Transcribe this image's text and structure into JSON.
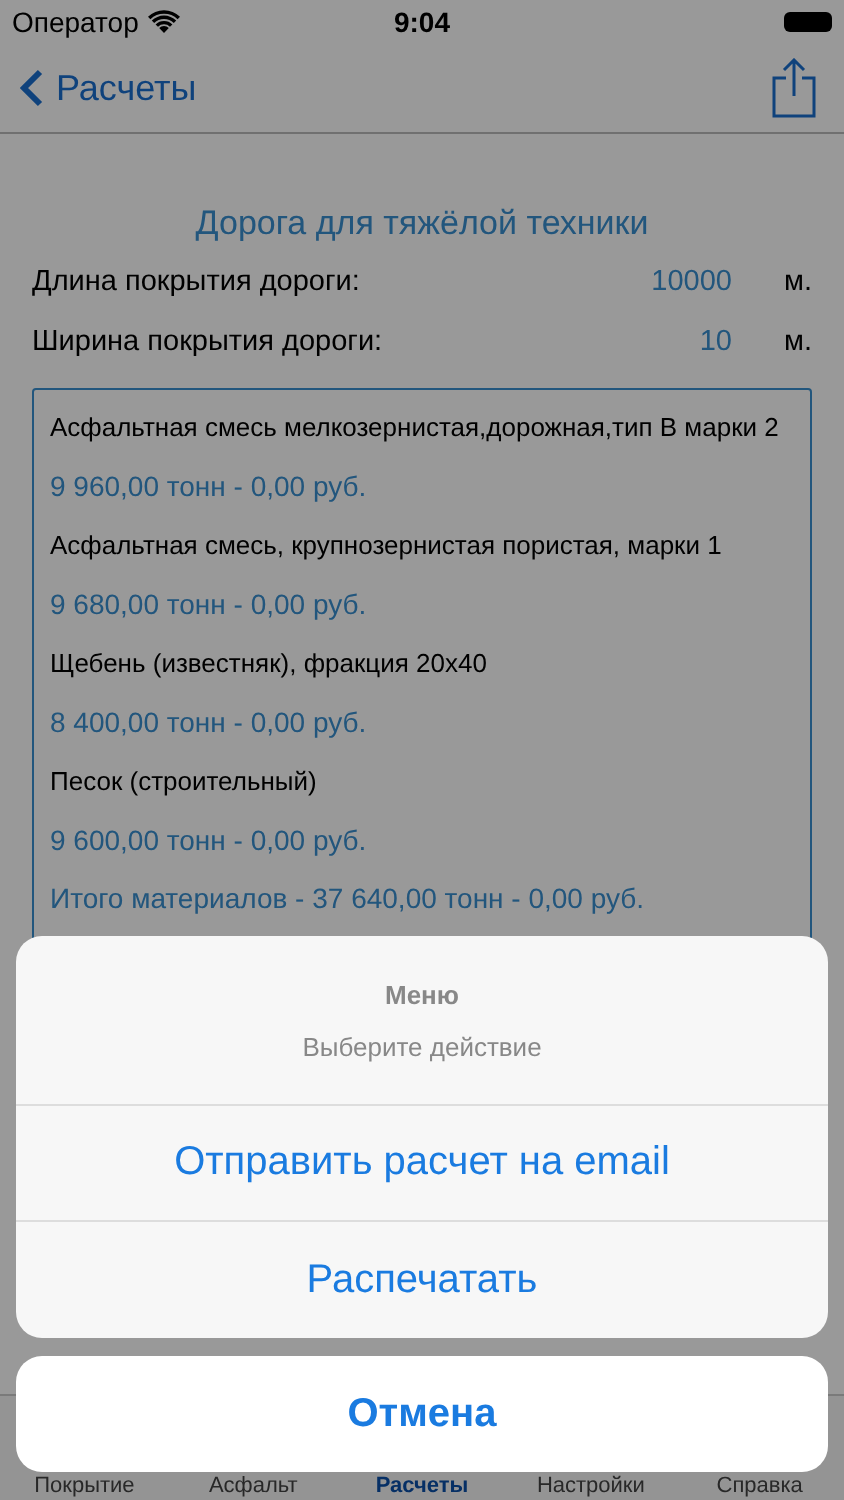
{
  "status_bar": {
    "carrier": "Оператор",
    "time": "9:04"
  },
  "nav": {
    "back": "Расчеты"
  },
  "title": "Дорога для тяжёлой техники",
  "params": [
    {
      "label": "Длина покрытия дороги:",
      "value": "10000",
      "unit": "м."
    },
    {
      "label": "Ширина покрытия дороги:",
      "value": "10",
      "unit": "м."
    }
  ],
  "results": [
    {
      "kind": "name",
      "text": "Асфальтная смесь мелкозернистая,дорожная,тип В марки 2"
    },
    {
      "kind": "amount",
      "text": "9 960,00 тонн - 0,00 руб."
    },
    {
      "kind": "name",
      "text": "Асфальтная смесь, крупнозернистая пористая, марки 1"
    },
    {
      "kind": "amount",
      "text": "9 680,00 тонн - 0,00 руб."
    },
    {
      "kind": "name",
      "text": "Щебень (известняк), фракция 20х40"
    },
    {
      "kind": "amount",
      "text": "8 400,00 тонн - 0,00 руб."
    },
    {
      "kind": "name",
      "text": "Песок (строительный)"
    },
    {
      "kind": "amount",
      "text": "9 600,00 тонн - 0,00 руб."
    },
    {
      "kind": "amount",
      "text": "Итого материалов - 37 640,00 тонн - 0,00 руб."
    }
  ],
  "tabs": [
    {
      "label": "Покрытие",
      "selected": false
    },
    {
      "label": "Асфальт",
      "selected": false
    },
    {
      "label": "Расчеты",
      "selected": true
    },
    {
      "label": "Настройки",
      "selected": false
    },
    {
      "label": "Справка",
      "selected": false
    }
  ],
  "action_sheet": {
    "title": "Меню",
    "message": "Выберите действие",
    "actions": [
      "Отправить расчет на email",
      "Распечатать"
    ],
    "cancel": "Отмена"
  }
}
